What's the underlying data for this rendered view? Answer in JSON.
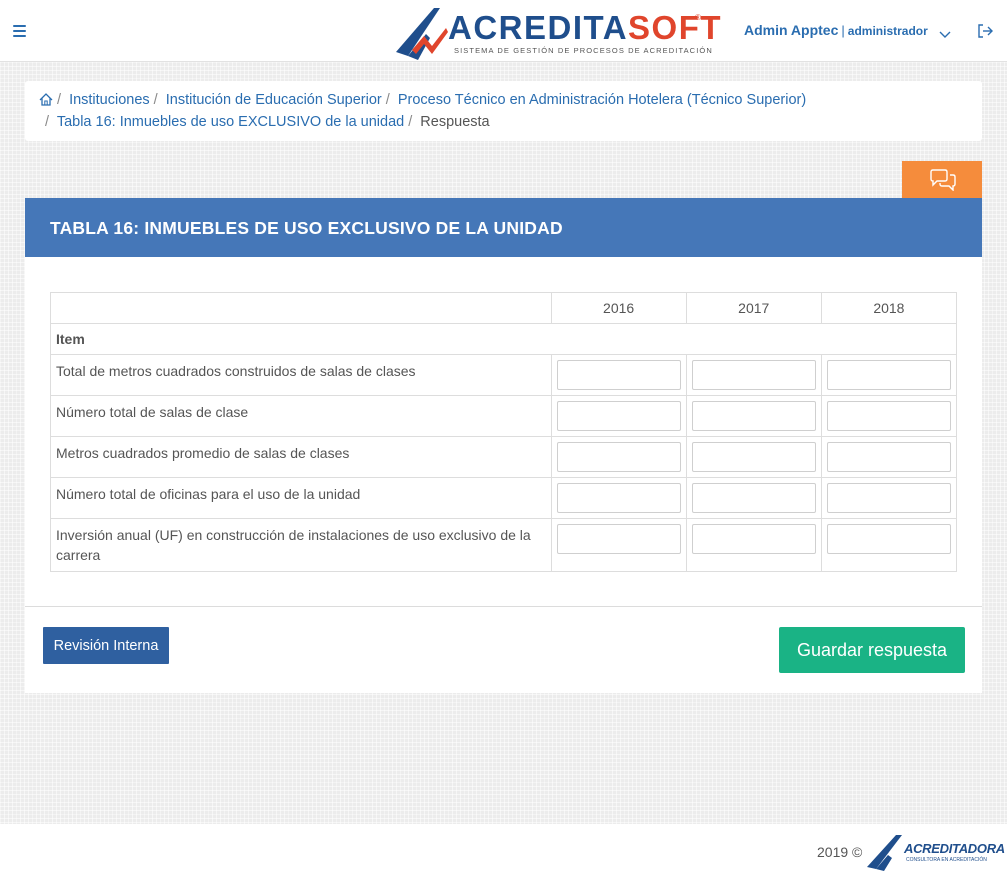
{
  "header": {
    "brand": {
      "name_part1": "ACREDITA",
      "name_part2": "SOFT",
      "registered": "®",
      "tagline": "SISTEMA DE GESTIÓN DE PROCESOS DE ACREDITACIÓN"
    },
    "user": {
      "name": "Admin Apptec",
      "separator": "|",
      "role": "administrador"
    },
    "icons": {
      "menu": "hamburger-menu-icon",
      "user_dropdown": "chevron-down-icon",
      "logout": "logout-icon"
    }
  },
  "breadcrumb": {
    "separator": "/",
    "home_icon": "home-icon",
    "items": [
      "Instituciones",
      "Institución de Educación Superior",
      "Proceso Técnico en Administración Hotelera (Técnico Superior)",
      "Tabla 16: Inmuebles de uso EXCLUSIVO de la unidad"
    ],
    "current": "Respuesta"
  },
  "comments_tab": {
    "icon": "comments-icon"
  },
  "panel": {
    "title": "TABLA 16: INMUEBLES DE USO EXCLUSIVO DE LA UNIDAD",
    "table": {
      "years": [
        "2016",
        "2017",
        "2018"
      ],
      "item_header": "Item",
      "rows": [
        {
          "label": "Total de metros cuadrados construidos de salas de clases",
          "values": [
            "",
            "",
            ""
          ]
        },
        {
          "label": "Número total de salas de clase",
          "values": [
            "",
            "",
            ""
          ]
        },
        {
          "label": "Metros cuadrados promedio de salas de clases",
          "values": [
            "",
            "",
            ""
          ]
        },
        {
          "label": "Número total de oficinas para el uso de la unidad",
          "values": [
            "",
            "",
            ""
          ]
        },
        {
          "label": "Inversión anual (UF) en construcción de instalaciones de uso exclusivo de la carrera",
          "values": [
            "",
            "",
            ""
          ]
        }
      ]
    },
    "buttons": {
      "internal_review": "Revisión Interna",
      "save": "Guardar respuesta"
    }
  },
  "footer": {
    "copyright": "2019 ©",
    "logo_name": "ACREDITADORA",
    "logo_sub": "CONSULTORA EN ACREDITACIÓN"
  },
  "colors": {
    "primary_blue": "#2a6db0",
    "panel_header": "#4577b8",
    "revision_button": "#2f60a0",
    "save_button": "#1ab385",
    "comments_tab": "#f58c3c",
    "brand_red": "#e0452c",
    "brand_navy": "#1f4e8c"
  }
}
